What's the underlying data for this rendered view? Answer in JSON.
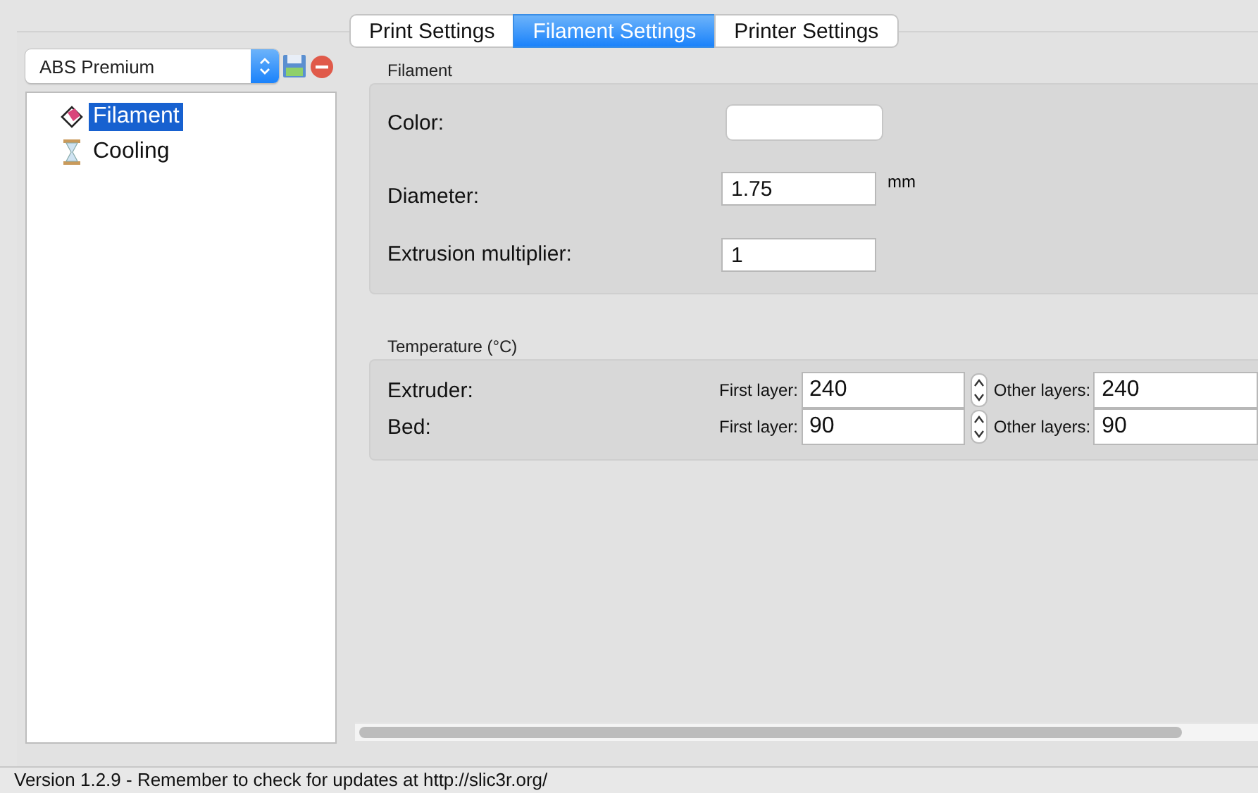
{
  "tabs": [
    {
      "label": "Print Settings",
      "selected": false
    },
    {
      "label": "Filament Settings",
      "selected": true
    },
    {
      "label": "Printer Settings",
      "selected": false
    }
  ],
  "preset": {
    "value": "ABS Premium"
  },
  "tree": [
    {
      "label": "Filament",
      "kind": "spool",
      "selected": true
    },
    {
      "label": "Cooling",
      "kind": "hourglass",
      "selected": false
    }
  ],
  "filament": {
    "title": "Filament",
    "color_label": "Color:",
    "diameter_label": "Diameter:",
    "diameter": "1.75",
    "diameter_unit": "mm",
    "multiplier_label": "Extrusion multiplier:",
    "multiplier": "1"
  },
  "temperature": {
    "title": "Temperature (°C)",
    "rows": [
      {
        "label": "Extruder:",
        "first_label": "First layer:",
        "first": "240",
        "other_label": "Other layers:",
        "other": "240"
      },
      {
        "label": "Bed:",
        "first_label": "First layer:",
        "first": "90",
        "other_label": "Other layers:",
        "other": "90"
      }
    ]
  },
  "status_bar": "Version 1.2.9 - Remember to check for updates at http://slic3r.org/"
}
